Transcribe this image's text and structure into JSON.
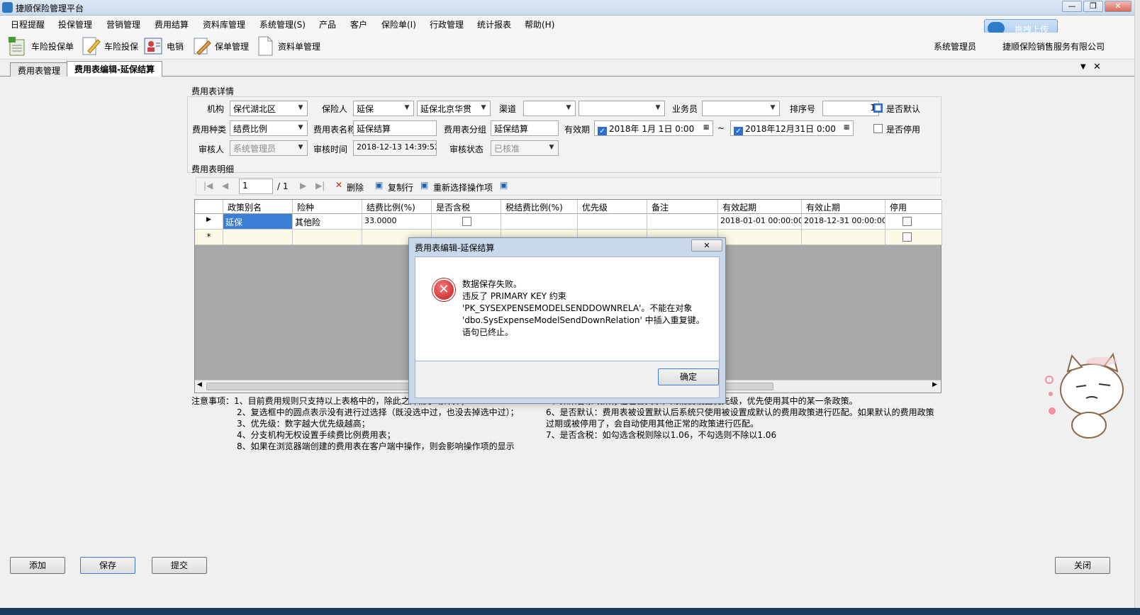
{
  "window": {
    "title": "捷顺保险管理平台"
  },
  "menu": [
    "日程提醒",
    "投保管理",
    "营销管理",
    "费用结算",
    "资料库管理",
    "系统管理(S)",
    "产品",
    "客户",
    "保险单(I)",
    "行政管理",
    "统计报表",
    "帮助(H)"
  ],
  "upload_label": "拖拽上传",
  "toolbar": {
    "items": [
      "车险投保单",
      "车险投保",
      "电销",
      "保单管理",
      "资料单管理"
    ],
    "user": "系统管理员",
    "company": "捷顺保险销售服务有限公司"
  },
  "tabs": [
    "费用表管理",
    "费用表编辑-延保结算"
  ],
  "details": {
    "section": "费用表详情",
    "org_label": "机构",
    "org_value": "保代湖北区",
    "insurer_label": "保险人",
    "insurer_value": "延保",
    "insurer_value2": "延保北京华贯",
    "channel_label": "渠道",
    "channel_value": "",
    "channel_value2": "",
    "salesman_label": "业务员",
    "salesman_value": "",
    "order_label": "排序号",
    "order_value": "1",
    "default_label": "是否默认",
    "type_label": "费用种类",
    "type_value": "结费比例",
    "name_label": "费用表名称",
    "name_value": "延保结算",
    "group_label": "费用表分组",
    "group_value": "延保结算",
    "valid_label": "有效期",
    "valid_from": "2018年 1月 1日   0:00",
    "tilde": "~",
    "valid_to": "2018年12月31日   0:00",
    "disabled_label": "是否停用",
    "reviewer_label": "审核人",
    "reviewer_value": "系统管理员",
    "review_time_label": "审核时间",
    "review_time_value": "2018-12-13 14:39:52",
    "review_status_label": "审核状态",
    "review_status_value": "已核准"
  },
  "detail_grid": {
    "section": "费用表明细",
    "nav": {
      "page": "1",
      "total": "/ 1"
    },
    "actions": [
      "删除",
      "复制行",
      "重新选择操作项"
    ],
    "columns": [
      "政策别名",
      "险种",
      "结费比例(%)",
      "是否含税",
      "税结费比例(%)",
      "优先级",
      "备注",
      "有效起期",
      "有效止期",
      "停用"
    ],
    "rows": [
      {
        "alias": "延保",
        "kind": "其他险",
        "ratio": "33.0000",
        "tax": "",
        "tax_ratio": "",
        "priority": "",
        "remark": "",
        "start": "2018-01-01 00:00:00",
        "end": "2018-12-31 00:00:00",
        "disabled": ""
      }
    ],
    "new_row_marker": "*"
  },
  "notes": {
    "left": [
      "注意事项：1、目前费用规则只支持以上表格中的，除此之外需手动计算；",
      "2、复选框中的圆点表示没有进行过选择（既没选中过，也没去掉选中过）；",
      "3、优先级：数字越大优先级越高；",
      "4、分支机构无权设置手续费比例费用表；",
      "8、如果在浏览器端创建的费用表在客户端中操作，则会影响操作项的显示"
    ],
    "right": [
      "5、如果各条政策存在包含关系，则需要设置优先级，优先使用其中的某一条政策。",
      "6、是否默认：费用表被设置默认后系统只使用被设置成默认的费用政策进行匹配。如果默认的费用政策",
      "过期或被停用了，会自动使用其他正常的政策进行匹配。",
      "7、是否含税：如勾选含税则除以1.06，不勾选则不除以1.06"
    ]
  },
  "buttons": {
    "add": "添加",
    "save": "保存",
    "submit": "提交",
    "close": "关闭"
  },
  "dialog": {
    "title": "费用表编辑-延保结算",
    "message": "数据保存失败。\n违反了 PRIMARY KEY 约束\n'PK_SYSEXPENSEMODELSENDDOWNRELA'。不能在对象\n'dbo.SysExpenseModelSendDownRelation' 中插入重复键。\n语句已终止。",
    "ok": "确定"
  }
}
